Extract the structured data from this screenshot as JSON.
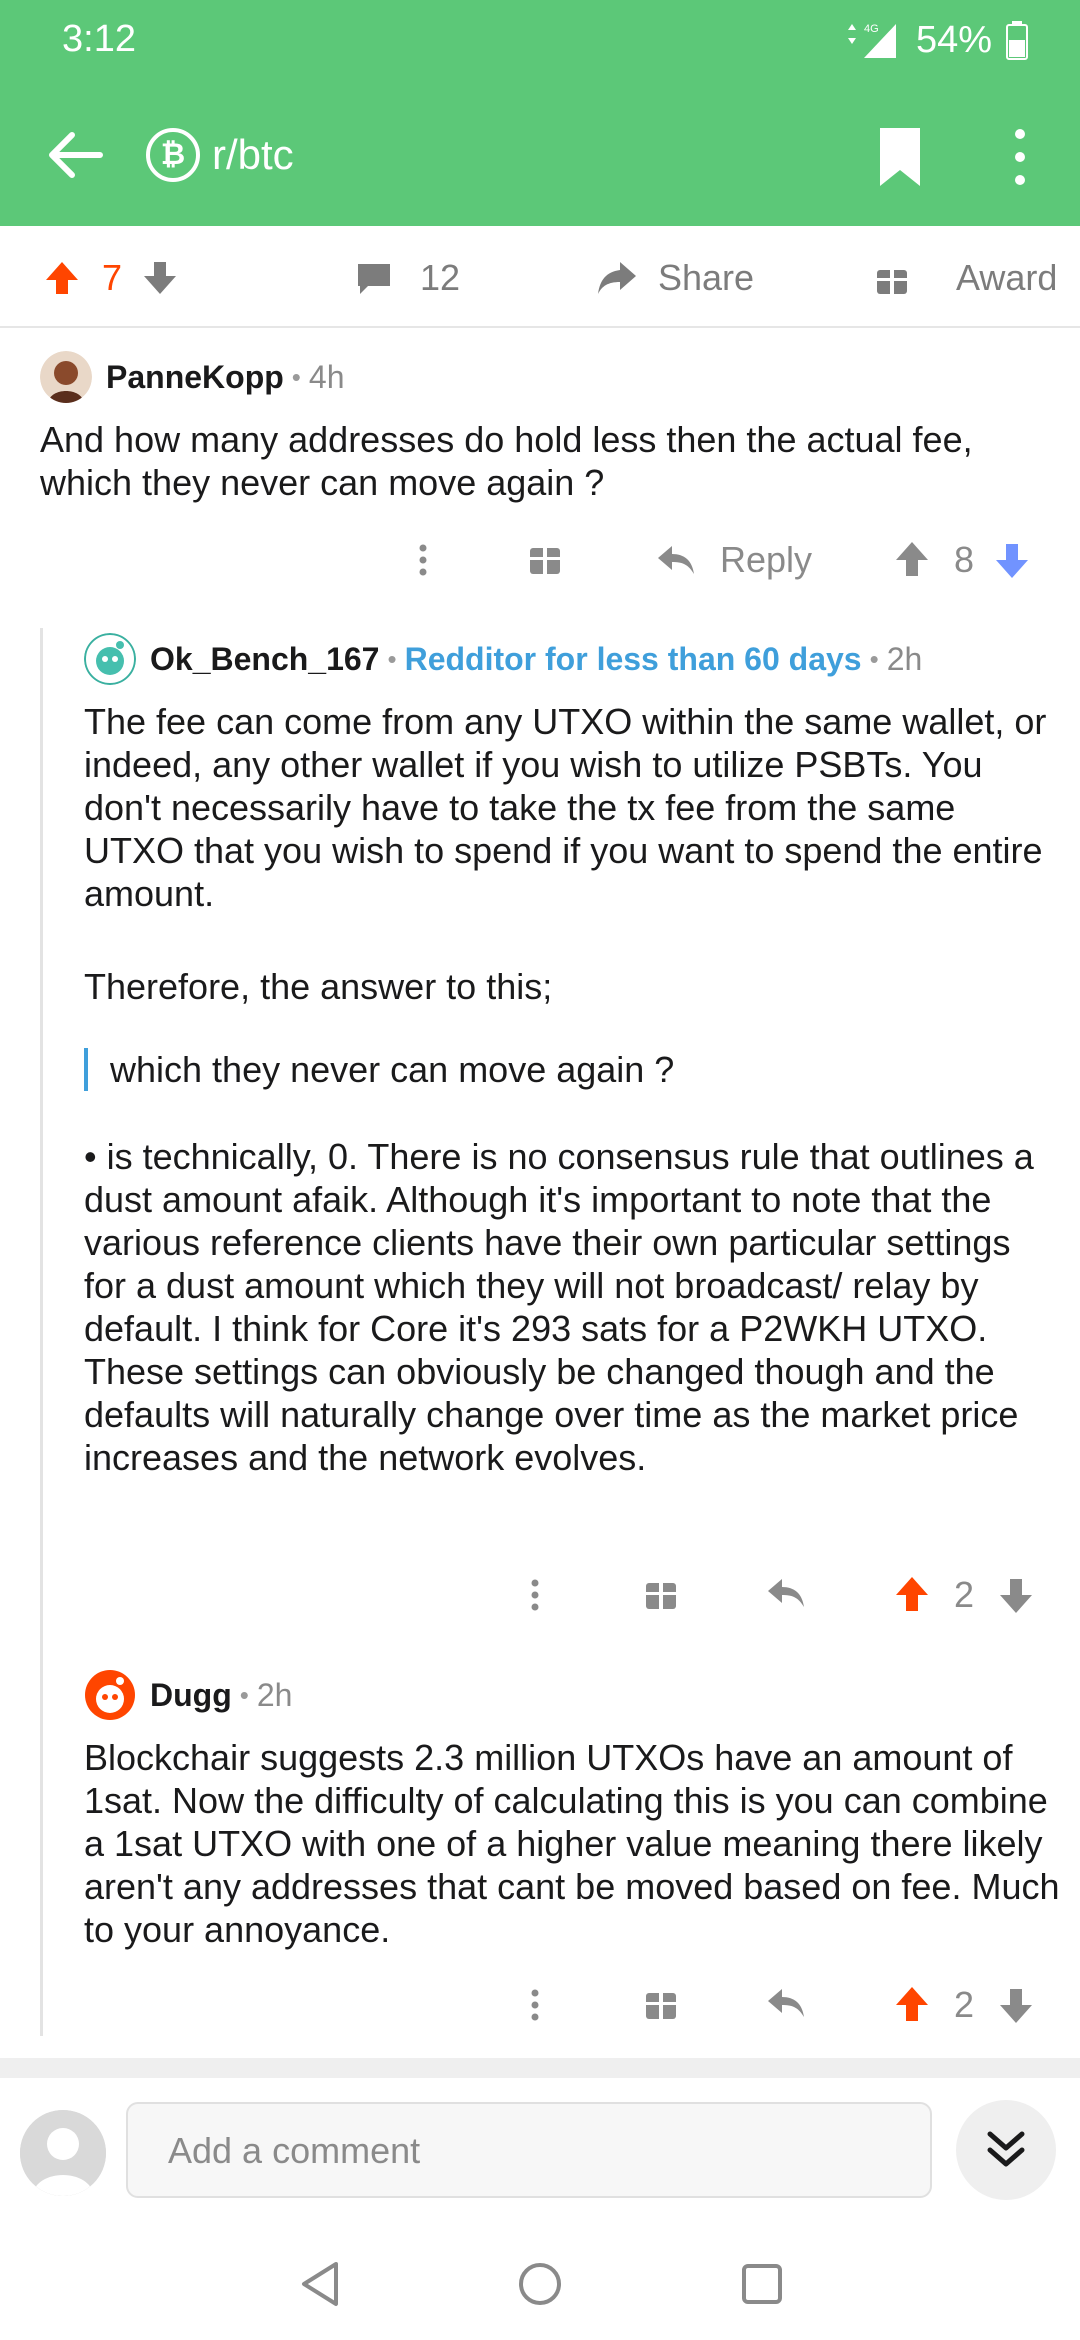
{
  "status": {
    "time": "3:12",
    "network": "4G",
    "battery": "54%"
  },
  "header": {
    "subreddit": "r/btc",
    "subreddit_icon": "bitcoin-icon"
  },
  "post_actions": {
    "score": "7",
    "comments": "12",
    "share": "Share",
    "award": "Award"
  },
  "comments": [
    {
      "author": "PanneKopp",
      "time": "4h",
      "body": "And how many addresses do hold less then the actual fee, which they never can move again ?",
      "reply_label": "Reply",
      "score": "8"
    },
    {
      "author": "Ok_Bench_167",
      "flair": "Redditor for less than 60 days",
      "time": "2h",
      "paragraphs": [
        "The fee can come from any UTXO within the same wallet, or indeed, any other wallet if you wish to utilize PSBTs.  You don't necessarily have to take the tx fee from the same UTXO that you wish to spend if you want to spend the entire amount.",
        "Therefore, the answer to this;"
      ],
      "quote": "which they never can move again ?",
      "bullet": "• is technically, 0.  There is no consensus rule that outlines a dust amount afaik.  Although it's important to note that the various reference clients have their own particular settings for a dust amount which they will not broadcast/ relay by default.  I think for Core it's 293 sats for a P2WKH UTXO.  These settings can obviously be changed though and the defaults will naturally change over time as the market price increases and the network evolves.",
      "score": "2"
    },
    {
      "author": "Dugg",
      "time": "2h",
      "body": "Blockchair suggests 2.3 million UTXOs have an amount of 1sat. Now the difficulty of calculating this is you can combine a 1sat UTXO with one of a higher value meaning there likely aren't any addresses that cant be moved based on fee. Much to your annoyance.",
      "score": "2"
    }
  ],
  "composer": {
    "placeholder": "Add a comment"
  },
  "colors": {
    "brand_green": "#5cc878",
    "upvote": "#ff4500",
    "downvote": "#7193ff",
    "flair": "#3f9fdb"
  }
}
